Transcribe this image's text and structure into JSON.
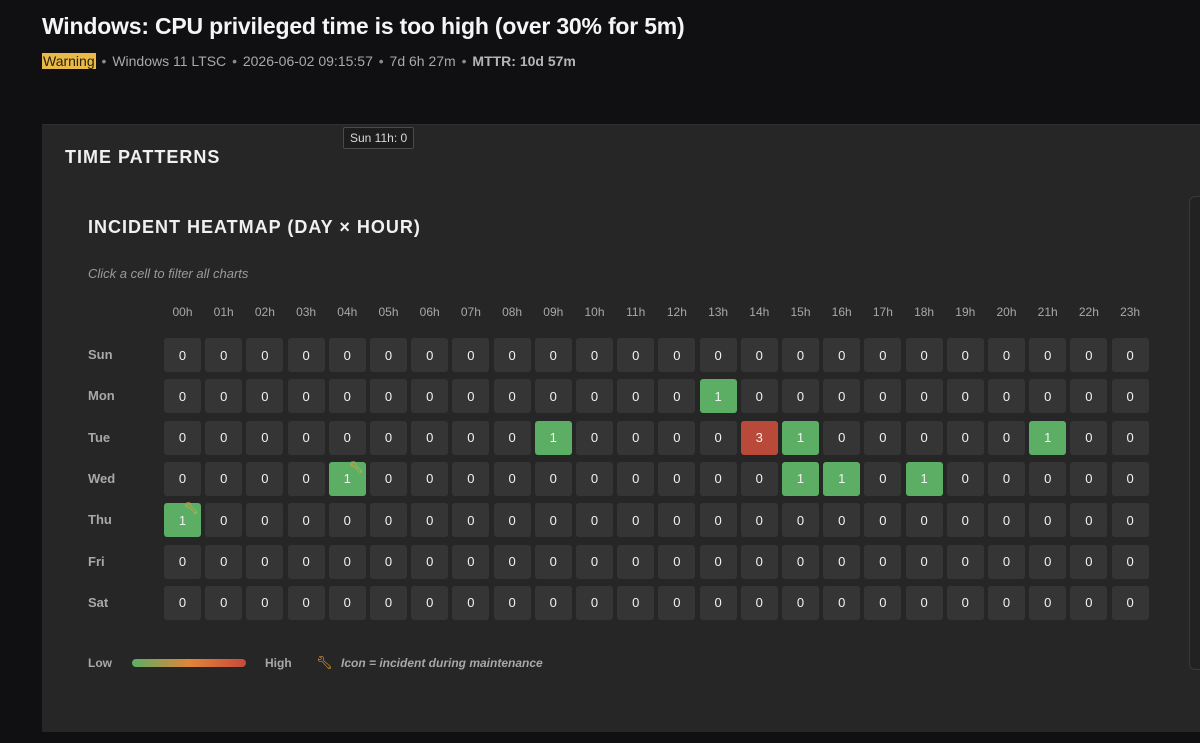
{
  "alert": {
    "title": "Windows: CPU privileged time is too high (over 30% for 5m)",
    "severity": "Warning",
    "os": "Windows 11 LTSC",
    "timestamp": "2026-06-02 09:15:57",
    "duration": "7d 6h 27m",
    "mttr": "MTTR: 10d 57m",
    "separator": "•"
  },
  "panel": {
    "title": "TIME PATTERNS"
  },
  "tooltip": "Sun 11h: 0",
  "heatmap": {
    "title": "INCIDENT HEATMAP (DAY × HOUR)",
    "subtitle": "Click a cell to filter all charts",
    "hours": [
      "00h",
      "01h",
      "02h",
      "03h",
      "04h",
      "05h",
      "06h",
      "07h",
      "08h",
      "09h",
      "10h",
      "11h",
      "12h",
      "13h",
      "14h",
      "15h",
      "16h",
      "17h",
      "18h",
      "19h",
      "20h",
      "21h",
      "22h",
      "23h"
    ],
    "days": [
      "Sun",
      "Mon",
      "Tue",
      "Wed",
      "Thu",
      "Fri",
      "Sat"
    ],
    "values": [
      [
        0,
        0,
        0,
        0,
        0,
        0,
        0,
        0,
        0,
        0,
        0,
        0,
        0,
        0,
        0,
        0,
        0,
        0,
        0,
        0,
        0,
        0,
        0,
        0
      ],
      [
        0,
        0,
        0,
        0,
        0,
        0,
        0,
        0,
        0,
        0,
        0,
        0,
        0,
        1,
        0,
        0,
        0,
        0,
        0,
        0,
        0,
        0,
        0,
        0
      ],
      [
        0,
        0,
        0,
        0,
        0,
        0,
        0,
        0,
        0,
        1,
        0,
        0,
        0,
        0,
        3,
        1,
        0,
        0,
        0,
        0,
        0,
        1,
        0,
        0
      ],
      [
        0,
        0,
        0,
        0,
        1,
        0,
        0,
        0,
        0,
        0,
        0,
        0,
        0,
        0,
        0,
        1,
        1,
        0,
        1,
        0,
        0,
        0,
        0,
        0
      ],
      [
        1,
        0,
        0,
        0,
        0,
        0,
        0,
        0,
        0,
        0,
        0,
        0,
        0,
        0,
        0,
        0,
        0,
        0,
        0,
        0,
        0,
        0,
        0,
        0
      ],
      [
        0,
        0,
        0,
        0,
        0,
        0,
        0,
        0,
        0,
        0,
        0,
        0,
        0,
        0,
        0,
        0,
        0,
        0,
        0,
        0,
        0,
        0,
        0,
        0
      ],
      [
        0,
        0,
        0,
        0,
        0,
        0,
        0,
        0,
        0,
        0,
        0,
        0,
        0,
        0,
        0,
        0,
        0,
        0,
        0,
        0,
        0,
        0,
        0,
        0
      ]
    ],
    "maintenance": [
      [
        3,
        4
      ],
      [
        4,
        0
      ]
    ],
    "colors": {
      "empty": "#353535",
      "low": "#5cae65",
      "mid": "#e0863a",
      "high": "#b94a3a",
      "maintenance_icon": "#f0a43a"
    },
    "maintenance_icon": "wrench-icon"
  },
  "legend": {
    "low": "Low",
    "high": "High",
    "note": "Icon = incident during maintenance"
  }
}
